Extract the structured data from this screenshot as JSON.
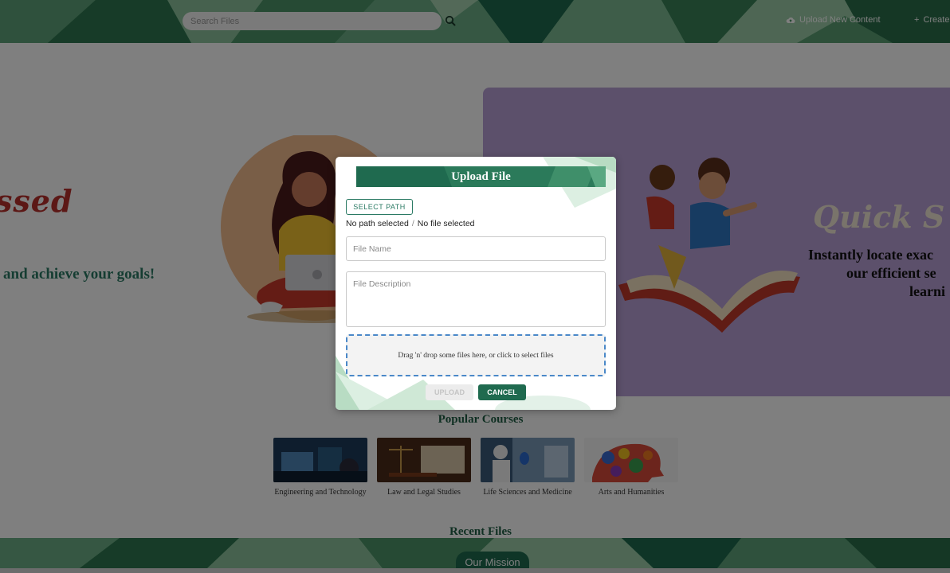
{
  "header": {
    "search": {
      "placeholder": "Search Files",
      "value": ""
    },
    "upload_link": "Upload New Content",
    "create_link": "Create"
  },
  "hero": {
    "title_fragment": "ssed",
    "subtitle": "and achieve your goals!",
    "quick_card": {
      "title": "Quick S",
      "lines": [
        "Instantly locate exac",
        "our efficient se",
        "learni"
      ]
    }
  },
  "popular_courses": {
    "heading": "Popular Courses",
    "items": [
      {
        "label": "Engineering and Technology"
      },
      {
        "label": "Law and Legal Studies"
      },
      {
        "label": "Life Sciences and Medicine"
      },
      {
        "label": "Arts and Humanities"
      }
    ]
  },
  "recent_files": {
    "heading": "Recent Files"
  },
  "footer": {
    "mission_label": "Our Mission"
  },
  "modal": {
    "title": "Upload File",
    "select_path_label": "SELECT PATH",
    "path_status": "No path selected",
    "path_separator": "/",
    "file_status": "No file selected",
    "file_name_placeholder": "File Name",
    "file_description_placeholder": "File Description",
    "dropzone_text": "Drag 'n' drop some files here, or click to select files",
    "upload_label": "UPLOAD",
    "cancel_label": "CANCEL"
  },
  "colors": {
    "brand_green": "#1f6a4f",
    "header_green": "#3f8a5c",
    "accent_red": "#b8302c",
    "card_purple": "#b9a0d6"
  }
}
